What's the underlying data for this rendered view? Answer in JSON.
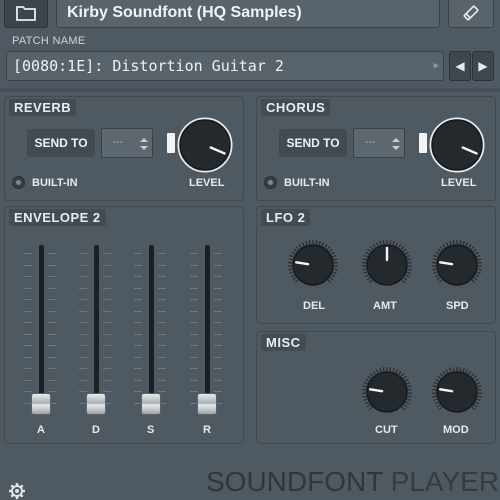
{
  "header": {
    "soundfont_name": "Kirby Soundfont (HQ Samples)",
    "patch_label": "PATCH NAME",
    "patch_value": "[0080:1E]: Distortion Guitar 2"
  },
  "reverb": {
    "title": "REVERB",
    "send_to_label": "SEND TO",
    "send_to_value": "---",
    "builtin_label": "BUILT-IN",
    "level_label": "LEVEL"
  },
  "chorus": {
    "title": "CHORUS",
    "send_to_label": "SEND TO",
    "send_to_value": "---",
    "builtin_label": "BUILT-IN",
    "level_label": "LEVEL"
  },
  "envelope": {
    "title": "ENVELOPE 2",
    "faders": [
      {
        "label": "A",
        "value": 0.0
      },
      {
        "label": "D",
        "value": 0.0
      },
      {
        "label": "S",
        "value": 0.0
      },
      {
        "label": "R",
        "value": 0.0
      }
    ]
  },
  "lfo": {
    "title": "LFO 2",
    "knobs": [
      {
        "label": "DEL",
        "value": 0.2
      },
      {
        "label": "AMT",
        "value": 0.5
      },
      {
        "label": "SPD",
        "value": 0.2
      }
    ]
  },
  "misc": {
    "title": "MISC",
    "knobs": [
      {
        "label": "CUT",
        "value": 0.2
      },
      {
        "label": "MOD",
        "value": 0.2
      }
    ]
  },
  "brand": {
    "part1": "SOUNDFONT",
    "part2": " PLAYER"
  },
  "icons": {
    "folder": "folder-icon",
    "edit": "pencil-icon",
    "prev": "arrow-left-icon",
    "next": "arrow-right-icon",
    "settings": "gear-icon"
  },
  "colors": {
    "background": "#4f5961",
    "panel_title_bg": "#434c53",
    "knob": "#24292d"
  }
}
